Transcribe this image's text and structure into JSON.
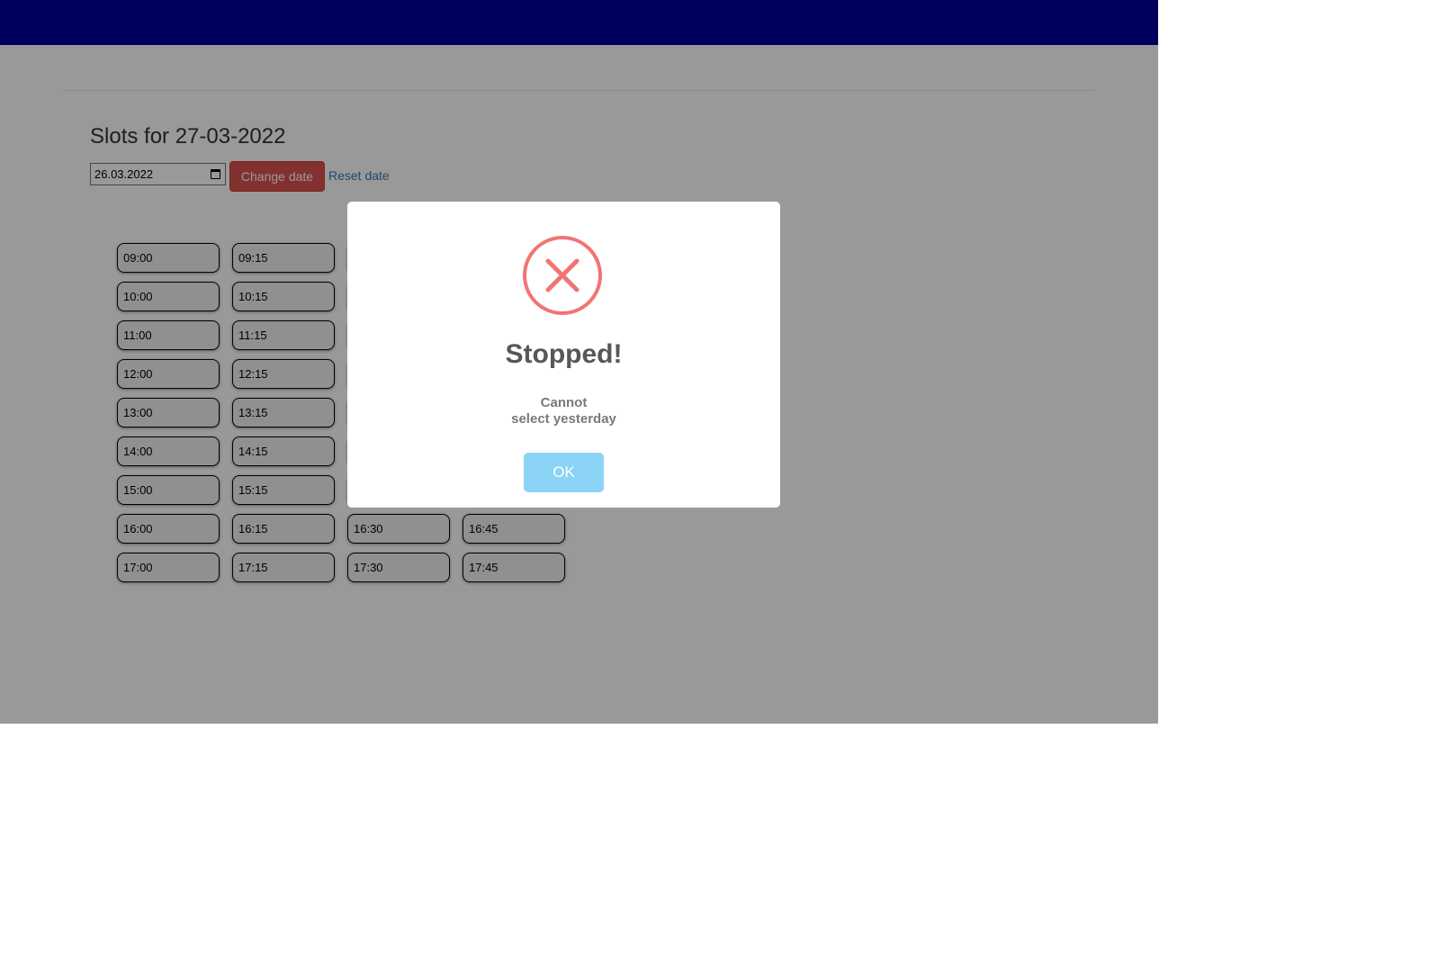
{
  "page": {
    "title": "Slots for 27-03-2022"
  },
  "controls": {
    "date_value": "26.03.2022",
    "change_date_label": "Change date",
    "reset_date_label": "Reset date"
  },
  "slots": [
    "09:00",
    "09:15",
    "",
    "",
    "10:00",
    "10:15",
    "",
    "",
    "11:00",
    "11:15",
    "",
    "",
    "12:00",
    "12:15",
    "",
    "",
    "13:00",
    "13:15",
    "",
    "",
    "14:00",
    "14:15",
    "",
    "",
    "15:00",
    "15:15",
    "",
    "",
    "16:00",
    "16:15",
    "16:30",
    "16:45",
    "17:00",
    "17:15",
    "17:30",
    "17:45"
  ],
  "modal": {
    "title": "Stopped!",
    "text_line1": "Cannot",
    "text_line2": "select yesterday",
    "ok_label": "OK",
    "icon": "error-x-circle-icon"
  },
  "colors": {
    "topbar": "#00009e",
    "change_button": "#d9534f",
    "ok_button": "#8cd4f5",
    "error_icon": "#f27474",
    "link": "#337ab7"
  }
}
